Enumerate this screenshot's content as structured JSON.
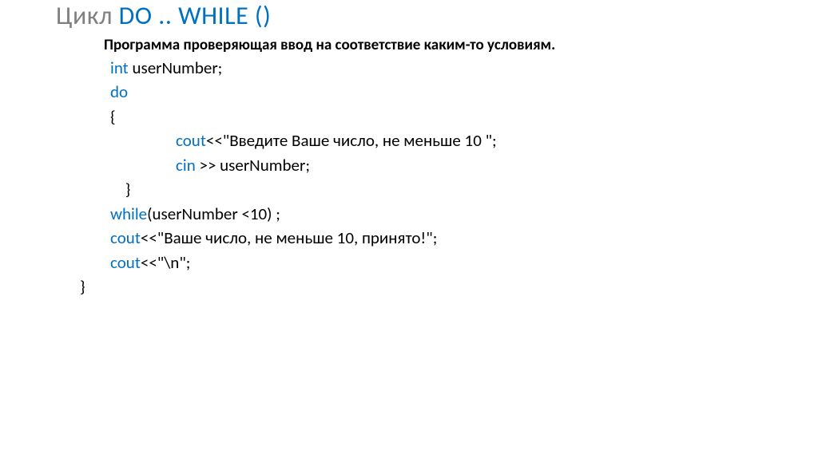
{
  "title": {
    "prefix": "Цикл ",
    "main": "DO ..  WHILE ()"
  },
  "subtitle": "Программа проверяющая ввод на соответствие каким-то условиям.",
  "code": {
    "line1_kw": "int",
    "line1_rest": " userNumber;",
    "line2_kw": "do",
    "line3": "{",
    "line4_kw": "cout",
    "line4_rest": "<<\"Введите Ваше число, не меньше 10 \";",
    "line5_kw": "cin",
    "line5_rest": " >> userNumber;",
    "line6": " }",
    "line7_kw": "while",
    "line7_rest": "(userNumber <10) ;",
    "line8_kw": "cout",
    "line8_rest": "<<\"Ваше число, не меньше 10, принято!\";",
    "line9_kw": "cout",
    "line9_rest": "<<\"\\n\";",
    "line10": "}"
  }
}
